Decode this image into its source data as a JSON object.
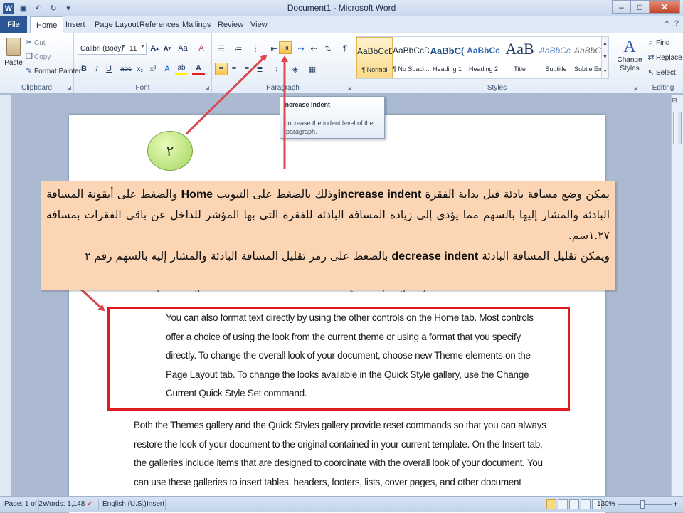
{
  "window": {
    "title": "Document1 - Microsoft Word"
  },
  "titlebar": {
    "qat": [
      {
        "icon": "word-logo-icon",
        "glyph": "W"
      },
      {
        "icon": "save-icon",
        "glyph": "▣"
      },
      {
        "icon": "undo-icon",
        "glyph": "↶"
      },
      {
        "icon": "redo-icon",
        "glyph": "↻"
      },
      {
        "icon": "qat-customize-icon",
        "glyph": "▾"
      }
    ],
    "controls": {
      "minimize": "–",
      "maximize": "□",
      "close": "✕"
    }
  },
  "tabs": [
    "File",
    "Home",
    "Insert",
    "Page Layout",
    "References",
    "Mailings",
    "Review",
    "View"
  ],
  "active_tab": "Home",
  "tabbar_right": {
    "minimize_ribbon": "^",
    "help": "?"
  },
  "clipboard": {
    "label": "Clipboard",
    "paste": "Paste",
    "cut": "Cut",
    "copy": "Copy",
    "format_painter": "Format Painter"
  },
  "font": {
    "label": "Font",
    "name": "Calibri (Body)",
    "size": "11",
    "grow": "A",
    "shrink": "A",
    "change_case": "Aa",
    "clear": "A",
    "bold": "B",
    "italic": "I",
    "underline": "U",
    "strike": "abc",
    "subscript": "x₂",
    "superscript": "x²",
    "text_effects": "A",
    "highlight": "ab",
    "font_color": "A"
  },
  "paragraph": {
    "label": "Paragraph",
    "show_marks": "¶"
  },
  "tooltip": {
    "title": "Increase Indent",
    "body": "Increase the indent level of the paragraph."
  },
  "styles": {
    "label": "Styles",
    "items": [
      {
        "sample": "AaBbCcDc",
        "name": "¶ Normal",
        "selected": true
      },
      {
        "sample": "AaBbCcDc",
        "name": "¶ No Spaci...",
        "selected": false
      },
      {
        "sample": "AaBbC(",
        "name": "Heading 1",
        "selected": false
      },
      {
        "sample": "AaBbCc",
        "name": "Heading 2",
        "selected": false
      },
      {
        "sample": "AaB",
        "name": "Title",
        "selected": false
      },
      {
        "sample": "AaBbCc.",
        "name": "Subtitle",
        "selected": false
      },
      {
        "sample": "AaBbCcDc",
        "name": "Subtle Em...",
        "selected": false
      }
    ],
    "change_styles": "Change Styles"
  },
  "editing": {
    "label": "Editing",
    "find": "Find",
    "replace": "Replace",
    "select": "Select"
  },
  "document": {
    "cut_line": "text by choosing a look for the selected  text from the Quick Styles gallery on the Home tab.",
    "indented_paragraph": "You can also format text directly by using the other controls on the Home tab. Most controls offer a choice of using the look from the current theme or using a format that you specify directly. To change the overall look of your document, choose new Theme elements  on the Page Layout tab. To change the looks available in the Quick Style gallery, use the Change Current Quick Style Set command.",
    "next_paragraph": "Both the Themes gallery and the Quick Styles gallery provide reset commands so that you can always restore the look of your document to the original contained in your current template. On the Insert tab, the galleries include items that are designed to coordinate with the overall look of your document. You can use these galleries to insert tables, headers, footers, lists, cover pages, and other document building"
  },
  "annotation": {
    "badge": "٢",
    "callout_line1_a": "يمكن وضع مسافة بادئة قبل بداية الفقرة ",
    "callout_line1_b": "increase indent",
    "callout_line1_c": "وذلك بالضغط على التبويب ",
    "callout_line1_d": "Home",
    "callout_line2": " والضغط على أيقونة المسافة البادئة والمشار إليها بالسهم مما يؤدى إلى زيادة المسافة البادئة للفقرة التى بها المؤشر للداخل عن باقى الفقرات بمسافة ١.٢٧سم.",
    "callout_line3_a": "ويمكن تقليل المسافة البادئة ",
    "callout_line3_b": "decrease indent",
    "callout_line3_c": " بالضغط على رمز تقليل المسافة البادئة والمشار إليه بالسهم رقم ٢",
    "accent_red": "#e11a20",
    "callout_fill": "#fcd6b4",
    "badge_fill": "#b8e07a"
  },
  "statusbar": {
    "page": "Page: 1 of 2",
    "words": "Words: 1,148",
    "language": "English (U.S.)",
    "mode": "Insert",
    "zoom": "130%",
    "zoom_minus": "−",
    "zoom_plus": "+"
  }
}
